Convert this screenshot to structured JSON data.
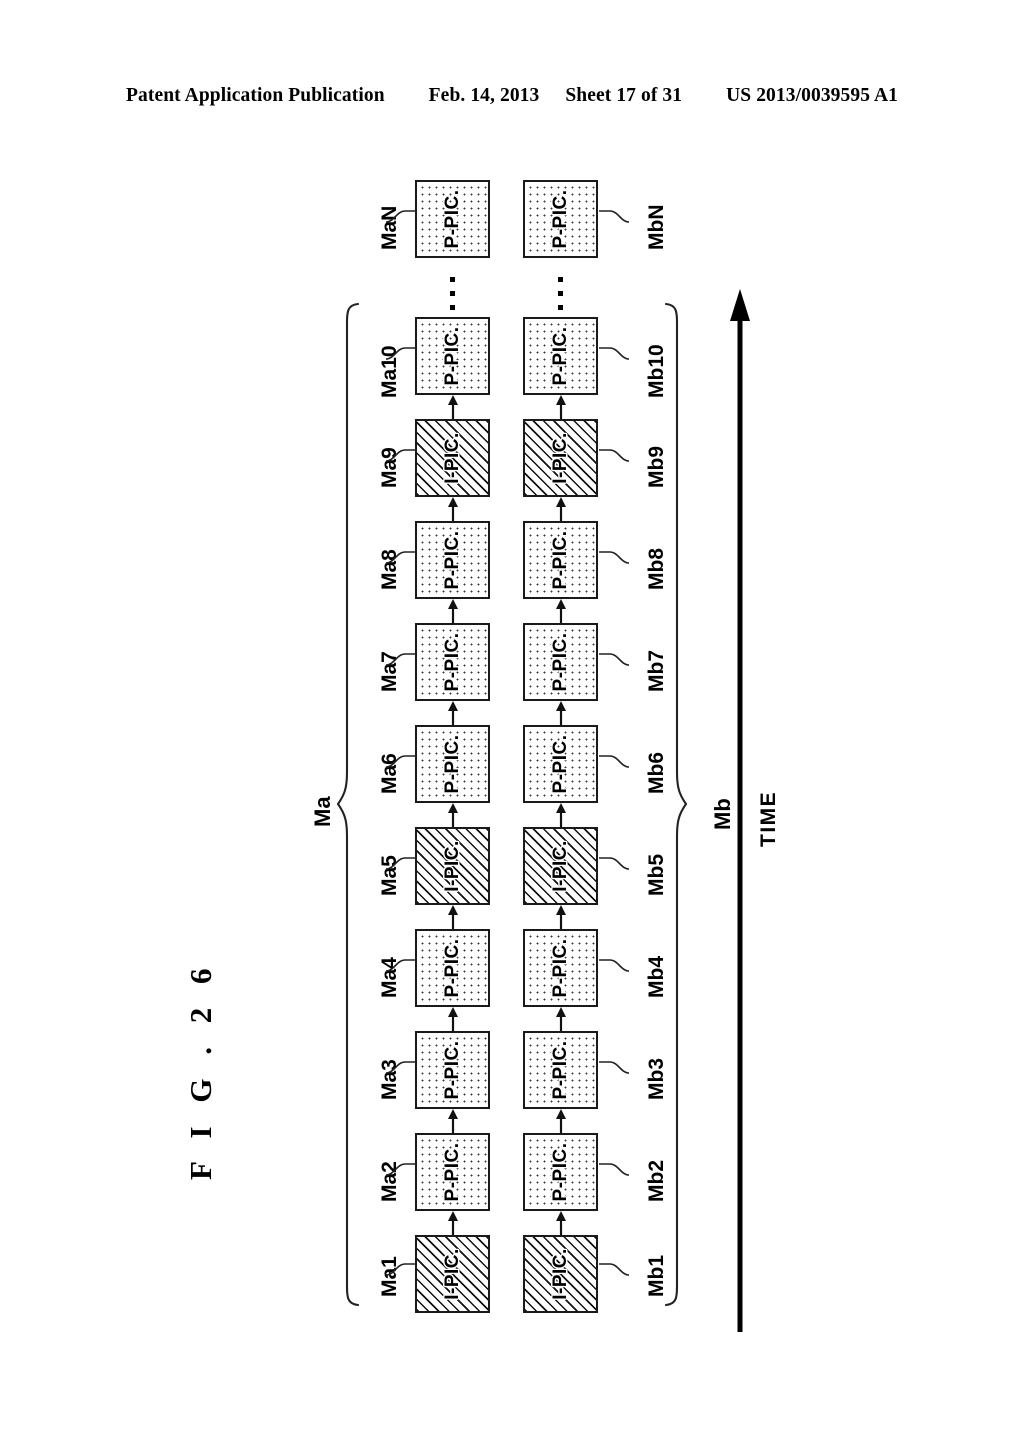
{
  "header": {
    "publication": "Patent Application Publication",
    "date": "Feb. 14, 2013",
    "sheet": "Sheet 17 of 31",
    "patent_number": "US 2013/0039595 A1"
  },
  "figure": {
    "caption": "F I G . 2 6",
    "caption_prefix": "F I G .",
    "caption_number": "2 6"
  },
  "diagram": {
    "time_axis": {
      "label": "TIME",
      "direction": "up"
    },
    "groups": [
      {
        "id": "Ma",
        "label": "Ma",
        "side": "left"
      },
      {
        "id": "Mb",
        "label": "Mb",
        "side": "right"
      }
    ],
    "picture_types": {
      "I": "I-PIC.",
      "P": "P-PIC."
    },
    "ellipsis": "⋮",
    "streams": [
      {
        "name": "Ma",
        "frames": [
          {
            "label": "Ma1",
            "type": "I",
            "text": "I-PIC."
          },
          {
            "label": "Ma2",
            "type": "P",
            "text": "P-PIC."
          },
          {
            "label": "Ma3",
            "type": "P",
            "text": "P-PIC."
          },
          {
            "label": "Ma4",
            "type": "P",
            "text": "P-PIC."
          },
          {
            "label": "Ma5",
            "type": "I",
            "text": "I-PIC."
          },
          {
            "label": "Ma6",
            "type": "P",
            "text": "P-PIC."
          },
          {
            "label": "Ma7",
            "type": "P",
            "text": "P-PIC."
          },
          {
            "label": "Ma8",
            "type": "P",
            "text": "P-PIC."
          },
          {
            "label": "Ma9",
            "type": "I",
            "text": "I-PIC."
          },
          {
            "label": "Ma10",
            "type": "P",
            "text": "P-PIC."
          },
          {
            "label": "MaN",
            "type": "P",
            "text": "P-PIC."
          }
        ]
      },
      {
        "name": "Mb",
        "frames": [
          {
            "label": "Mb1",
            "type": "I",
            "text": "I-PIC."
          },
          {
            "label": "Mb2",
            "type": "P",
            "text": "P-PIC."
          },
          {
            "label": "Mb3",
            "type": "P",
            "text": "P-PIC."
          },
          {
            "label": "Mb4",
            "type": "P",
            "text": "P-PIC."
          },
          {
            "label": "Mb5",
            "type": "I",
            "text": "I-PIC."
          },
          {
            "label": "Mb6",
            "type": "P",
            "text": "P-PIC."
          },
          {
            "label": "Mb7",
            "type": "P",
            "text": "P-PIC."
          },
          {
            "label": "Mb8",
            "type": "P",
            "text": "P-PIC."
          },
          {
            "label": "Mb9",
            "type": "I",
            "text": "I-PIC."
          },
          {
            "label": "Mb10",
            "type": "P",
            "text": "P-PIC."
          },
          {
            "label": "MbN",
            "type": "P",
            "text": "P-PIC."
          }
        ]
      }
    ]
  },
  "colors": {
    "ink": "#000000",
    "paper": "#ffffff",
    "box_border": "#1a1a1a"
  }
}
